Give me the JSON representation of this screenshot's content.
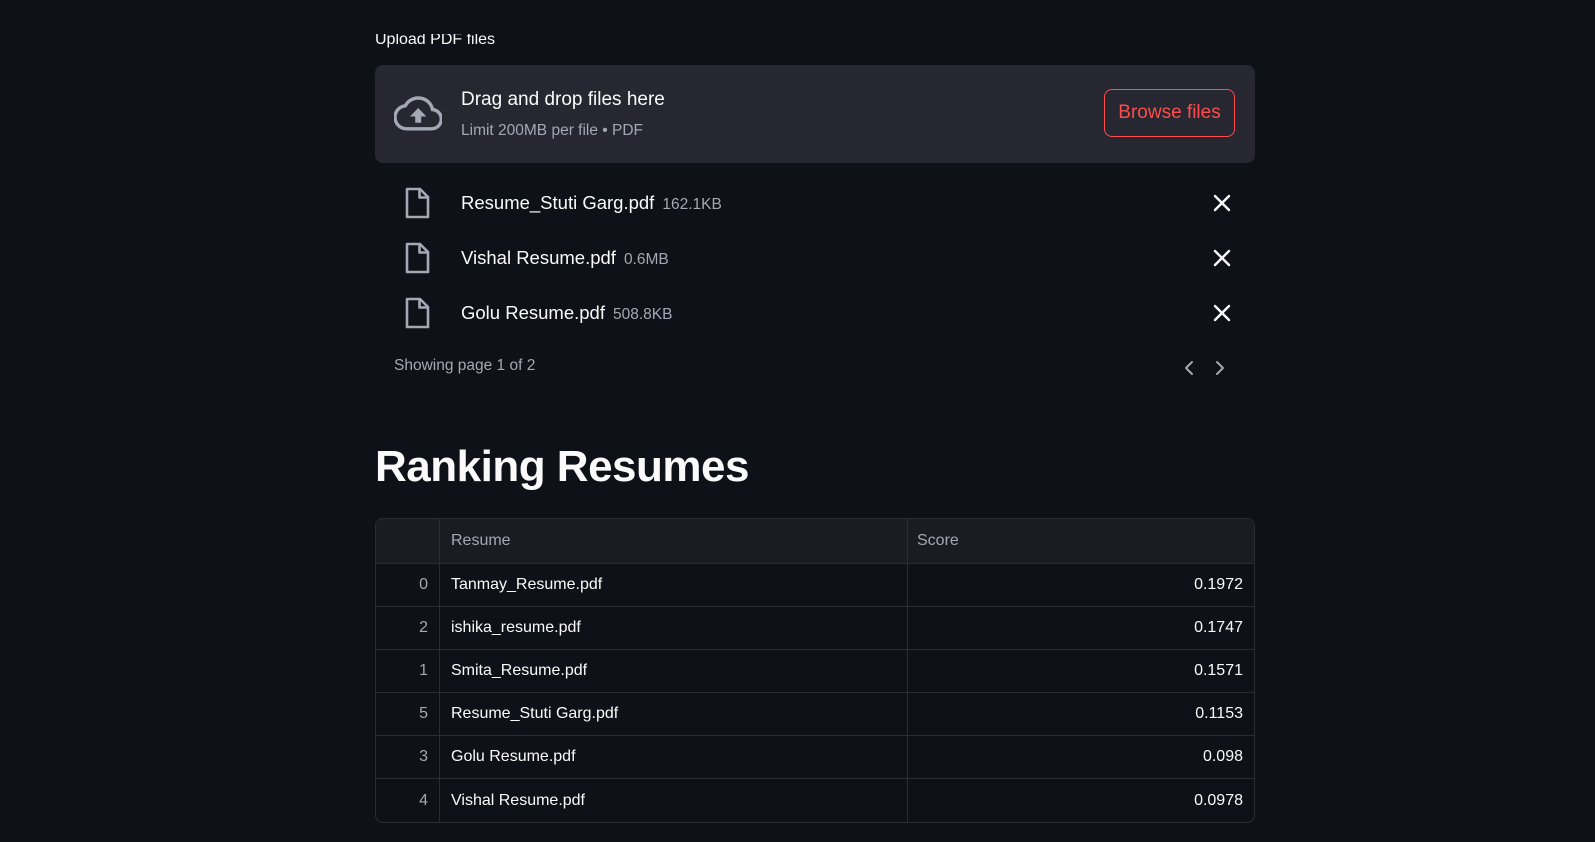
{
  "uploader": {
    "label": "Upload PDF files",
    "dropzone_title": "Drag and drop files here",
    "dropzone_subtitle": "Limit 200MB per file • PDF",
    "browse_label": "Browse files",
    "accent_color": "#ff4b4b"
  },
  "files": [
    {
      "name": "Resume_Stuti Garg.pdf",
      "size": "162.1KB"
    },
    {
      "name": "Vishal Resume.pdf",
      "size": "0.6MB"
    },
    {
      "name": "Golu Resume.pdf",
      "size": "508.8KB"
    }
  ],
  "pagination": {
    "text": "Showing page 1 of 2"
  },
  "ranking": {
    "title": "Ranking Resumes",
    "columns": [
      "",
      "Resume",
      "Score"
    ],
    "rows": [
      {
        "index": "0",
        "resume": "Tanmay_Resume.pdf",
        "score": "0.1972"
      },
      {
        "index": "2",
        "resume": "ishika_resume.pdf",
        "score": "0.1747"
      },
      {
        "index": "1",
        "resume": "Smita_Resume.pdf",
        "score": "0.1571"
      },
      {
        "index": "5",
        "resume": "Resume_Stuti Garg.pdf",
        "score": "0.1153"
      },
      {
        "index": "3",
        "resume": "Golu Resume.pdf",
        "score": "0.098"
      },
      {
        "index": "4",
        "resume": "Vishal Resume.pdf",
        "score": "0.0978"
      }
    ]
  },
  "icons": {
    "upload": "cloud-upload-icon",
    "file": "file-icon",
    "remove": "close-icon",
    "prev": "chevron-left-icon",
    "next": "chevron-right-icon"
  }
}
